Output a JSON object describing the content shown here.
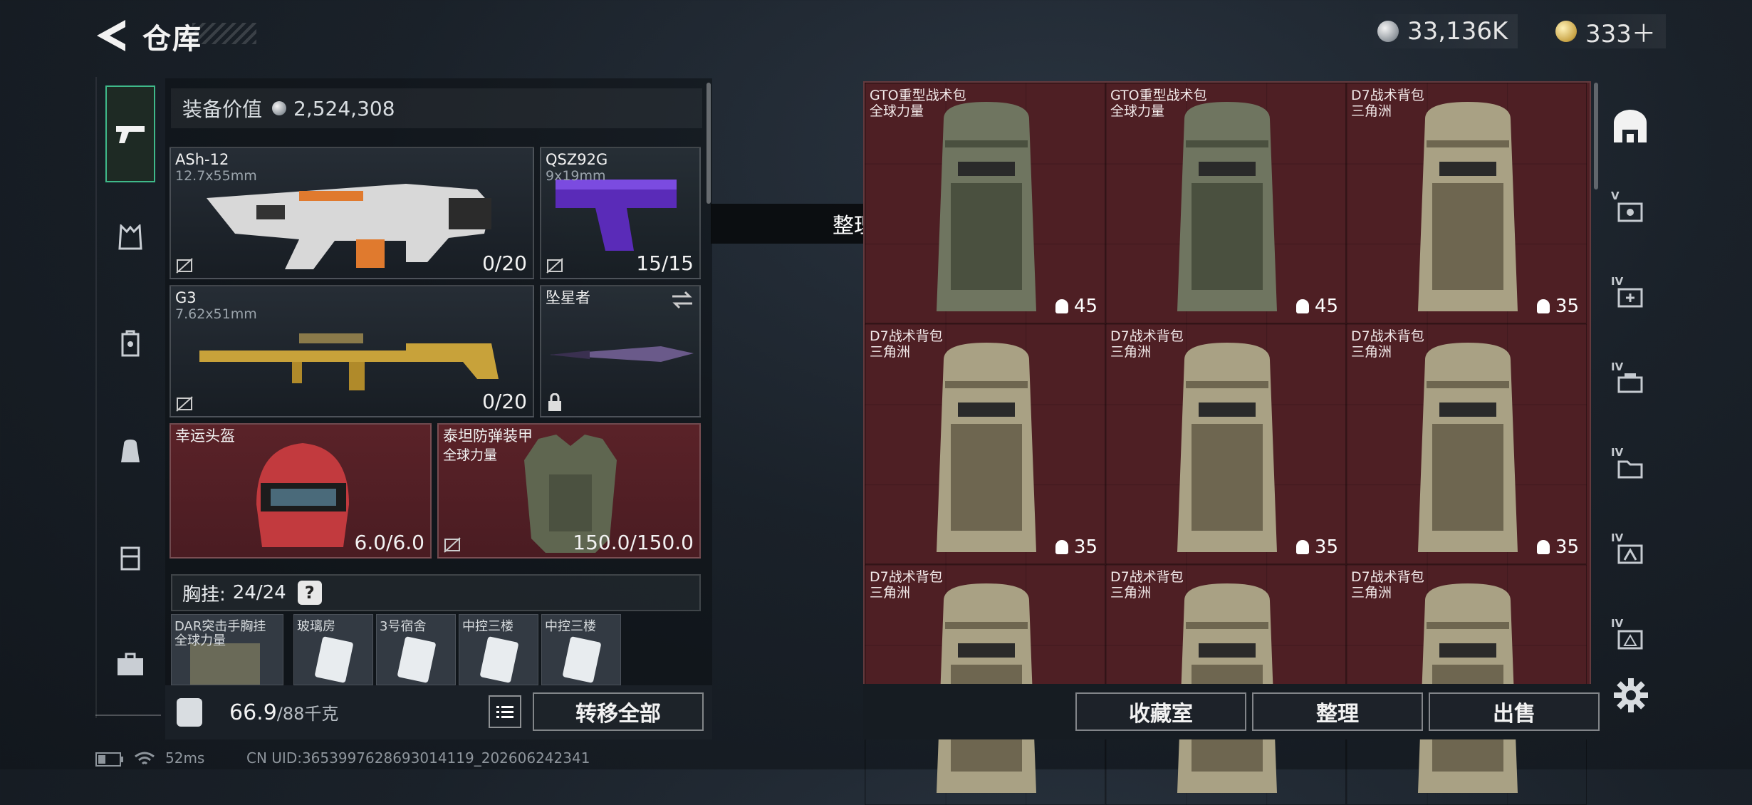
{
  "header": {
    "title": "仓库",
    "silver_amount": "33,136K",
    "gold_amount": "333＋"
  },
  "loadout": {
    "value_label": "装备价值",
    "value": "2,524,308",
    "slots": [
      {
        "name": "ASh-12",
        "sub": "12.7x55mm",
        "count": "0/20"
      },
      {
        "name": "QSZ92G",
        "sub": "9x19mm",
        "count": "15/15"
      },
      {
        "name": "G3",
        "sub": "7.62x51mm",
        "count": "0/20"
      },
      {
        "name": "坠星者",
        "sub": "",
        "count": ""
      },
      {
        "name": "幸运头盔",
        "sub": "",
        "count": "6.0/6.0"
      },
      {
        "name": "泰坦防弹装甲",
        "sub": "全球力量",
        "count": "150.0/150.0"
      }
    ],
    "vest_label": "胸挂:",
    "vest_count": "24/24",
    "vest_help": "?",
    "vest_items": [
      {
        "name": "DAR突击手胸挂",
        "sub": "全球力量"
      },
      {
        "name": "玻璃房"
      },
      {
        "name": "3号宿舍"
      },
      {
        "name": "中控三楼"
      },
      {
        "name": "中控三楼"
      }
    ],
    "weight_value": "66.9",
    "weight_max": "/88千克",
    "transfer_all": "转移全部"
  },
  "toast": "整理成功",
  "storage": {
    "items": [
      {
        "name": "GTO重型战术包",
        "sub": "全球力量",
        "capacity": "45"
      },
      {
        "name": "GTO重型战术包",
        "sub": "全球力量",
        "capacity": "45"
      },
      {
        "name": "D7战术背包",
        "sub": "三角洲",
        "capacity": "35"
      },
      {
        "name": "D7战术背包",
        "sub": "三角洲",
        "capacity": "35"
      },
      {
        "name": "D7战术背包",
        "sub": "三角洲",
        "capacity": "35"
      },
      {
        "name": "D7战术背包",
        "sub": "三角洲",
        "capacity": "35"
      },
      {
        "name": "D7战术背包",
        "sub": "三角洲",
        "capacity": ""
      },
      {
        "name": "D7战术背包",
        "sub": "三角洲",
        "capacity": ""
      },
      {
        "name": "D7战术背包",
        "sub": "三角洲",
        "capacity": ""
      }
    ],
    "buttons": {
      "collection": "收藏室",
      "organize": "整理",
      "sell": "出售"
    },
    "tabs": [
      "V",
      "IV",
      "IV",
      "IV",
      "IV",
      "IV"
    ]
  },
  "status_bar": {
    "ping": "52ms",
    "uid": "CN UID:3653997628693014119_202606242341"
  },
  "colors": {
    "storage_bg": "#4e1f24",
    "accent": "#3fb98a"
  }
}
